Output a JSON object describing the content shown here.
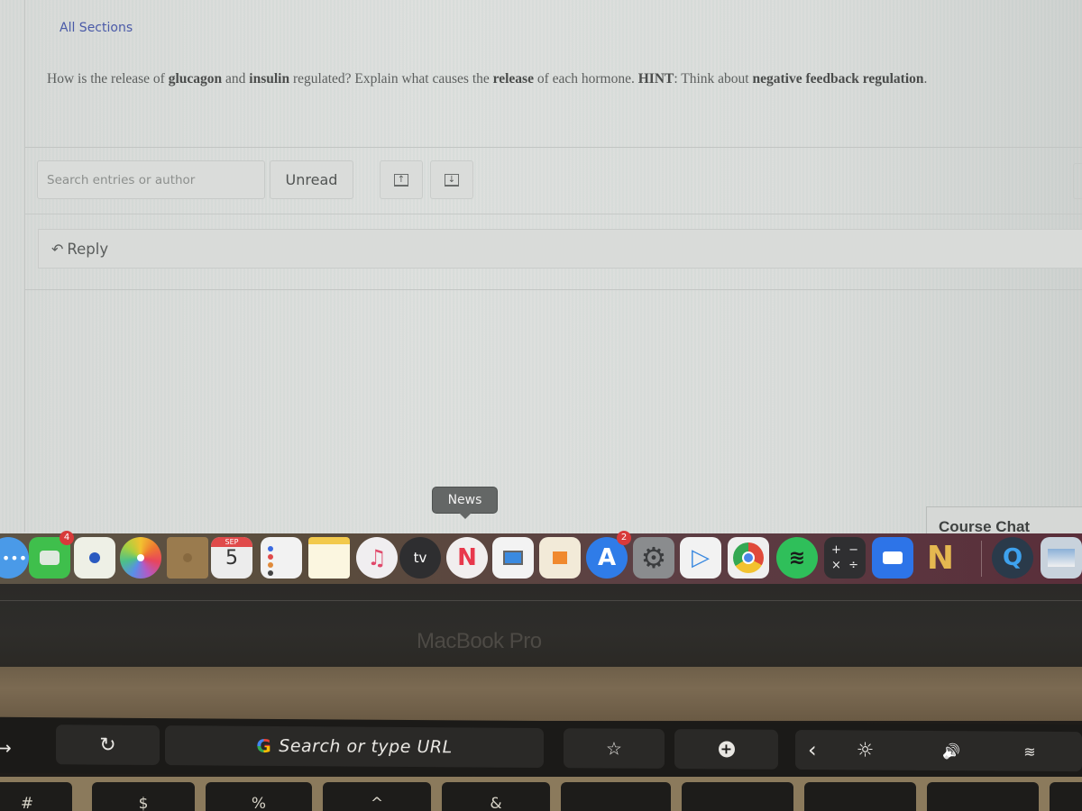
{
  "discussion": {
    "section_filter": "All Sections",
    "question": {
      "segments": [
        {
          "text": "How is the release of ",
          "bold": false
        },
        {
          "text": "glucagon",
          "bold": true
        },
        {
          "text": " and ",
          "bold": false
        },
        {
          "text": "insulin",
          "bold": true
        },
        {
          "text": " regulated? Explain what causes the ",
          "bold": false
        },
        {
          "text": "release",
          "bold": true
        },
        {
          "text": " of each hormone. ",
          "bold": false
        },
        {
          "text": "HINT",
          "bold": true
        },
        {
          "text": ": Think about ",
          "bold": false
        },
        {
          "text": "negative feedback regulation",
          "bold": true
        },
        {
          "text": ".",
          "bold": false
        }
      ]
    },
    "toolbar": {
      "search_placeholder": "Search entries or author",
      "unread_label": "Unread",
      "expand_glyph": "↑",
      "collapse_glyph": "↓"
    },
    "reply": {
      "arrow": "↶",
      "label": "Reply"
    }
  },
  "tooltip": {
    "text": "News"
  },
  "course_chat": {
    "label": "Course Chat"
  },
  "dock": {
    "items": [
      {
        "name": "messages",
        "badge": null
      },
      {
        "name": "facetime",
        "badge": "4"
      },
      {
        "name": "maps",
        "badge": null
      },
      {
        "name": "photos",
        "badge": null
      },
      {
        "name": "contacts",
        "badge": null
      },
      {
        "name": "calendar",
        "badge": null,
        "month": "SEP",
        "day": "5"
      },
      {
        "name": "reminders",
        "badge": null
      },
      {
        "name": "notes",
        "badge": null
      },
      {
        "name": "music",
        "badge": null
      },
      {
        "name": "tv",
        "badge": null,
        "label": "tv"
      },
      {
        "name": "news",
        "badge": null
      },
      {
        "name": "keynote",
        "badge": null
      },
      {
        "name": "pages",
        "badge": null
      },
      {
        "name": "app-store",
        "badge": "2"
      },
      {
        "name": "system-preferences",
        "badge": null
      },
      {
        "name": "infuse",
        "badge": null
      },
      {
        "name": "chrome",
        "badge": null
      },
      {
        "name": "spotify",
        "badge": null
      },
      {
        "name": "calculator",
        "badge": null
      },
      {
        "name": "zoom",
        "badge": null
      },
      {
        "name": "notability",
        "badge": null
      },
      {
        "name": "quicktime",
        "badge": null
      },
      {
        "name": "preview",
        "badge": null
      }
    ]
  },
  "bezel": {
    "label": "MacBook Pro"
  },
  "touchbar": {
    "reload_glyph": "↻",
    "url_prompt": "Search or type URL",
    "google_glyph": "G",
    "star_glyph": "☆",
    "add_glyph": "+",
    "collapse_glyph": "‹",
    "brightness_glyph": "☼",
    "volume_glyph": "🔊",
    "back_glyph": "→"
  },
  "keyboard": {
    "keys": [
      "#",
      "$",
      "%",
      "^",
      "&"
    ]
  }
}
